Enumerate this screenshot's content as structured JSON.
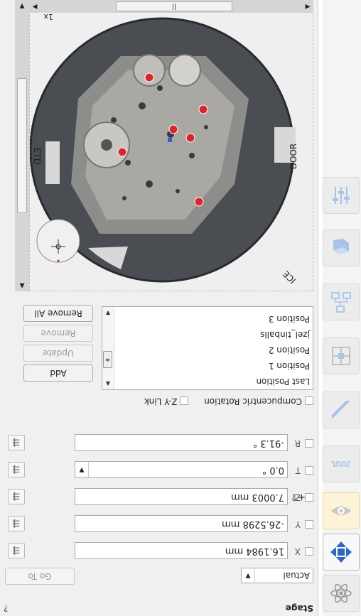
{
  "panel": {
    "title": "Stage",
    "help": "?"
  },
  "mode": {
    "selected": "Actual",
    "go_to_label": "Go To"
  },
  "axes": [
    {
      "label": "X",
      "value": "16.1984 mm"
    },
    {
      "label": "Y",
      "value": "-26.5298 mm"
    },
    {
      "label": "Z",
      "value": "7.0003 mm",
      "hint": "+⇧"
    },
    {
      "label": "T",
      "value": "0.0 °"
    },
    {
      "label": "R",
      "value": "-91.3 °"
    }
  ],
  "options": {
    "compucentric": "Compucentric Rotation",
    "zy_link": "Z-Y Link"
  },
  "positions": {
    "items": [
      "Last Position",
      "Position 1",
      "Position 2",
      "jzel_tinballs",
      "Position 3"
    ],
    "buttons": {
      "add": "Add",
      "update": "Update",
      "remove": "Remove",
      "remove_all": "Remove All"
    }
  },
  "view": {
    "zoom": "1x",
    "labels": {
      "door": "DOOR",
      "etd": "ETD",
      "ice": "ICE"
    }
  },
  "colors": {
    "marker": "#d9262c",
    "active_icon": "#2f66c8",
    "highlight": "#fdf3d6"
  }
}
